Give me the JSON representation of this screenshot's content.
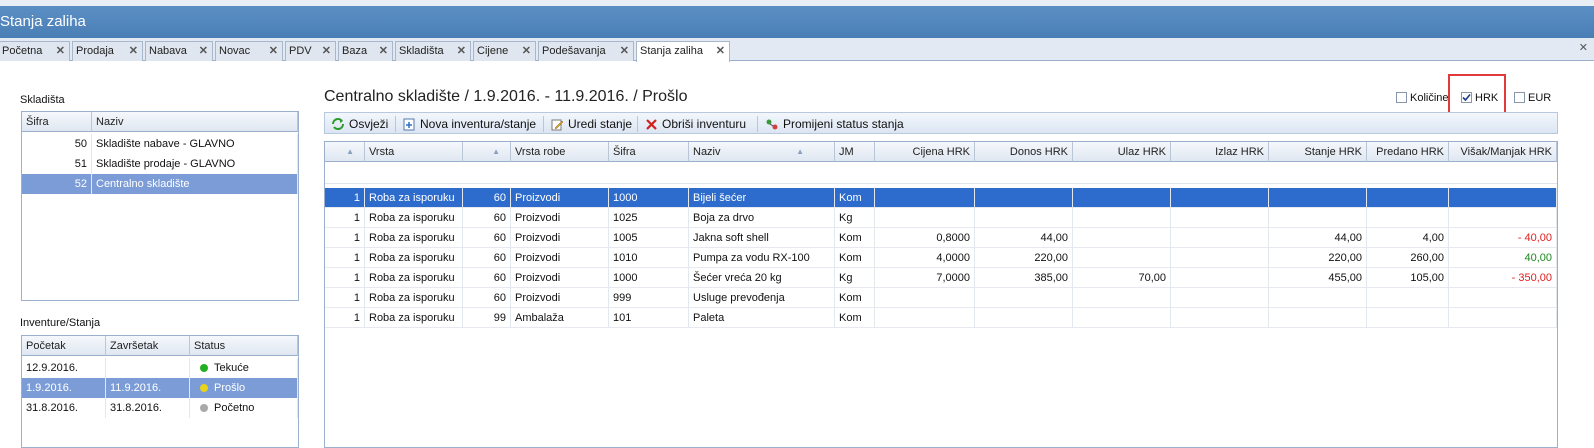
{
  "window": {
    "title": "Stanja zaliha"
  },
  "tabs": [
    {
      "label": "Početna"
    },
    {
      "label": "Prodaja"
    },
    {
      "label": "Nabava"
    },
    {
      "label": "Novac"
    },
    {
      "label": "PDV"
    },
    {
      "label": "Baza"
    },
    {
      "label": "Skladišta"
    },
    {
      "label": "Cijene"
    },
    {
      "label": "Podešavanja"
    },
    {
      "label": "Stanja zaliha"
    }
  ],
  "skladista": {
    "label": "Skladišta",
    "columns": [
      "Šifra",
      "Naziv"
    ],
    "rows": [
      {
        "sifra": "50",
        "naziv": "Skladište nabave - GLAVNO"
      },
      {
        "sifra": "51",
        "naziv": "Skladište prodaje - GLAVNO"
      },
      {
        "sifra": "52",
        "naziv": "Centralno skladište"
      }
    ]
  },
  "inventure": {
    "label": "Inventure/Stanja",
    "columns": [
      "Početak",
      "Završetak",
      "Status"
    ],
    "rows": [
      {
        "pocetak": "12.9.2016.",
        "zavrsetak": "",
        "status": "Tekuće",
        "color": "#22b022"
      },
      {
        "pocetak": "1.9.2016.",
        "zavrsetak": "11.9.2016.",
        "status": "Prošlo",
        "color": "#e8d21a"
      },
      {
        "pocetak": "31.8.2016.",
        "zavrsetak": "31.8.2016.",
        "status": "Početno",
        "color": "#a9a9a9"
      }
    ]
  },
  "main": {
    "title": "Centralno skladište / 1.9.2016. -  11.9.2016. / Prošlo",
    "currency": [
      {
        "label": "Količine",
        "checked": false
      },
      {
        "label": "HRK",
        "checked": true
      },
      {
        "label": "EUR",
        "checked": false
      }
    ],
    "toolbar": {
      "refresh": "Osvježi",
      "new": "Nova inventura/stanje",
      "edit": "Uredi stanje",
      "delete": "Obriši inventuru",
      "status": "Promijeni status stanja"
    },
    "columns": [
      "",
      "Vrsta",
      "",
      "Vrsta robe",
      "Šifra",
      "Naziv",
      "JM",
      "Cijena HRK",
      "Donos HRK",
      "Ulaz HRK",
      "Izlaz HRK",
      "Stanje HRK",
      "Predano HRK",
      "Višak/Manjak HRK"
    ],
    "rows": [
      [
        "1",
        "Roba za isporuku",
        "60",
        "Proizvodi",
        "1000",
        "Bijeli šećer",
        "Kom",
        "",
        "",
        "",
        "",
        "",
        "",
        ""
      ],
      [
        "1",
        "Roba za isporuku",
        "60",
        "Proizvodi",
        "1025",
        "Boja za drvo",
        "Kg",
        "",
        "",
        "",
        "",
        "",
        "",
        ""
      ],
      [
        "1",
        "Roba za isporuku",
        "60",
        "Proizvodi",
        "1005",
        "Jakna soft shell",
        "Kom",
        "0,8000",
        "44,00",
        "",
        "",
        "44,00",
        "4,00",
        "- 40,00"
      ],
      [
        "1",
        "Roba za isporuku",
        "60",
        "Proizvodi",
        "1010",
        "Pumpa za vodu RX-100",
        "Kom",
        "4,0000",
        "220,00",
        "",
        "",
        "220,00",
        "260,00",
        "40,00"
      ],
      [
        "1",
        "Roba za isporuku",
        "60",
        "Proizvodi",
        "1000",
        "Šećer vreća 20 kg",
        "Kg",
        "7,0000",
        "385,00",
        "70,00",
        "",
        "455,00",
        "105,00",
        "- 350,00"
      ],
      [
        "1",
        "Roba za isporuku",
        "60",
        "Proizvodi",
        "999",
        "Usluge prevođenja",
        "Kom",
        "",
        "",
        "",
        "",
        "",
        "",
        ""
      ],
      [
        "1",
        "Roba za isporuku",
        "99",
        "Ambalaža",
        "101",
        "Paleta",
        "Kom",
        "",
        "",
        "",
        "",
        "",
        "",
        ""
      ]
    ]
  }
}
